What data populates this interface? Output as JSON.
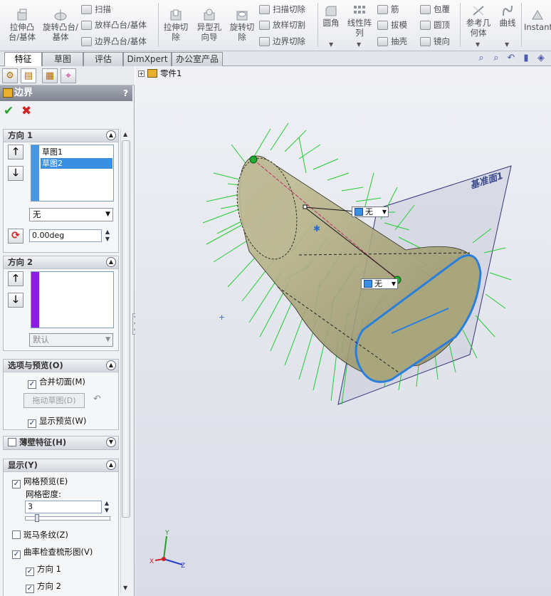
{
  "ribbon": {
    "extrude_boss": "拉伸凸台/基体",
    "revolve_boss": "旋转凸台/基体",
    "sweep": "扫描",
    "loft_boss": "放样凸台/基体",
    "boundary_boss": "边界凸台/基体",
    "extrude_cut": "拉伸切除",
    "hole_wizard": "异型孔向导",
    "revolve_cut": "旋转切除",
    "swept_cut": "扫描切除",
    "lofted_cut": "放样切割",
    "boundary_cut": "边界切除",
    "fillet": "圆角",
    "linear_pattern": "线性阵列",
    "rib": "筋",
    "draft": "拔模",
    "shell": "抽壳",
    "wrap": "包覆",
    "dome": "圆顶",
    "mirror": "镜向",
    "ref_geometry": "参考几何体",
    "curves": "曲线",
    "instant3d": "Instant"
  },
  "tabs": [
    "特征",
    "草图",
    "评估",
    "DimXpert",
    "办公室产品"
  ],
  "panel": {
    "title": "边界",
    "help": "?",
    "dir1": {
      "title": "方向 1",
      "items": [
        "草图1",
        "草图2"
      ],
      "tangency": "无",
      "angle": "0.00deg"
    },
    "dir2": {
      "title": "方向 2",
      "tangency": "默认"
    },
    "options": {
      "title": "选项与预览(O)",
      "merge_faces": "合并切面(M)",
      "drag_sketch": "拖动草图(D)",
      "show_preview": "显示预览(W)"
    },
    "thin_feature": "薄壁特征(H)",
    "display": {
      "title": "显示(Y)",
      "mesh_preview": "网格预览(E)",
      "mesh_density_label": "网格密度:",
      "mesh_density": "3",
      "zebra": "斑马条纹(Z)",
      "curvature_comb": "曲率检查梳形图(V)",
      "dir1": "方向 1",
      "dir2": "方向 2"
    }
  },
  "viewport": {
    "tree_root": "零件1",
    "plane_label": "基准面1",
    "callout1": "无",
    "callout2": "无",
    "axis_x": "X",
    "axis_y": "Y",
    "axis_z": "Z"
  },
  "colors": {
    "comb_green": "#22cc33",
    "selection_blue": "#2a7fdc",
    "surface_tan": "#b2ae84",
    "list_bar_blue": "#4a96e6",
    "list_bar_purple": "#8a1ee6"
  }
}
